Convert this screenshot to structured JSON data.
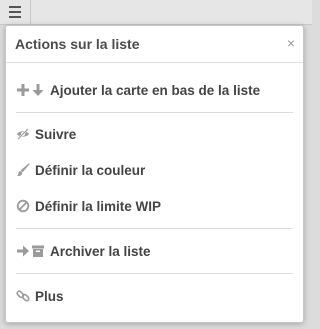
{
  "popover": {
    "title": "Actions sur la liste",
    "close_symbol": "×"
  },
  "menu": {
    "add_card_bottom": "Ajouter la carte en bas de la liste",
    "follow": "Suivre",
    "set_color": "Définir la couleur",
    "set_wip_limit": "Définir la limite WIP",
    "archive_list": "Archiver la liste",
    "more": "Plus"
  },
  "icons": {
    "menu": "hamburger-icon",
    "add": "plus-icon",
    "down": "arrow-down-icon",
    "follow": "eye-slash-icon",
    "color": "paintbrush-icon",
    "wip": "ban-icon",
    "archive_arrow": "arrow-right-icon",
    "archive_box": "archive-icon",
    "more": "link-icon"
  },
  "colors": {
    "icon": "#9b9b9b",
    "text": "#444444",
    "title": "#4d4d4d"
  }
}
